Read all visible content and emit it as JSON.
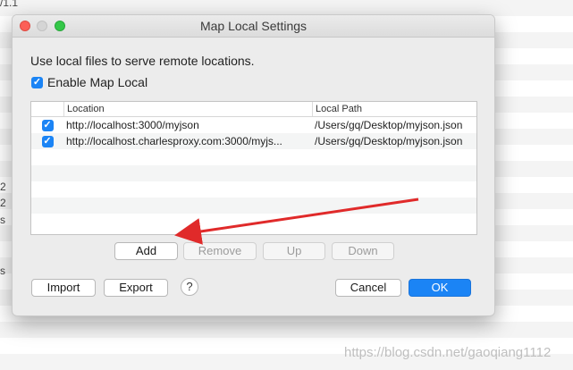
{
  "background": {
    "fragments": [
      "/1.1",
      "2",
      "2",
      "s",
      "s"
    ]
  },
  "dialog": {
    "title": "Map Local Settings",
    "intro": "Use local files to serve remote locations.",
    "enable_label": "Enable Map Local",
    "enable_checked": true,
    "table": {
      "columns": [
        "Location",
        "Local Path"
      ],
      "rows": [
        {
          "checked": true,
          "location": "http://localhost:3000/myjson",
          "local_path": "/Users/gq/Desktop/myjson.json"
        },
        {
          "checked": true,
          "location": "http://localhost.charlesproxy.com:3000/myjs...",
          "local_path": "/Users/gq/Desktop/myjson.json"
        }
      ]
    },
    "buttons": {
      "add": "Add",
      "remove": "Remove",
      "up": "Up",
      "down": "Down",
      "import": "Import",
      "export": "Export",
      "help": "?",
      "cancel": "Cancel",
      "ok": "OK"
    }
  },
  "annotation": {
    "arrow_color": "#e02a2a"
  },
  "watermark": "https://blog.csdn.net/gaoqiang1112",
  "colors": {
    "accent": "#1b84f5",
    "close": "#fc5f57",
    "zoom": "#34c748"
  }
}
